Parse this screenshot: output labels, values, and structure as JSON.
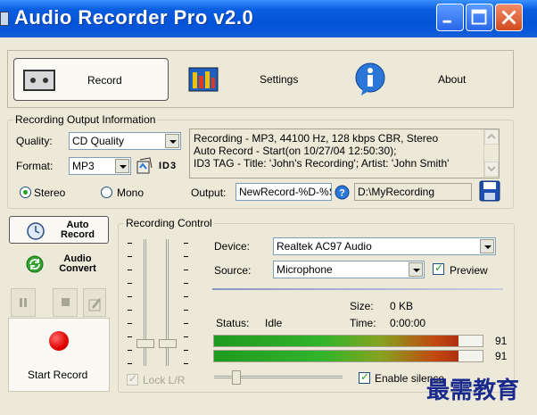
{
  "window": {
    "title": "Audio Recorder Pro v2.0"
  },
  "nav": {
    "record": "Record",
    "settings": "Settings",
    "about": "About"
  },
  "output_info": {
    "group_title": "Recording Output Information",
    "quality_label": "Quality:",
    "quality_value": "CD Quality",
    "format_label": "Format:",
    "format_value": "MP3",
    "id3_label": "ID3",
    "info_lines": [
      "Recording - MP3, 44100 Hz, 128 kbps CBR, Stereo",
      "Auto Record - Start(on 10/27/04 12:50:30);",
      "ID3 TAG - Title: 'John's Recording'; Artist: 'John Smith'"
    ],
    "stereo_label": "Stereo",
    "mono_label": "Mono",
    "selected_channel": "Stereo",
    "output_label": "Output:",
    "output_name": "NewRecord-%D-%S",
    "output_dir": "D:\\MyRecording"
  },
  "side": {
    "auto_record": "Auto\nRecord",
    "audio_convert": "Audio\nConvert",
    "start_record": "Start Record"
  },
  "recording_control": {
    "group_title": "Recording Control",
    "device_label": "Device:",
    "device_value": "Realtek AC97 Audio",
    "source_label": "Source:",
    "source_value": "Microphone",
    "preview_label": "Preview",
    "preview_checked": true,
    "size_label": "Size:",
    "size_value": "0 KB",
    "status_label": "Status:",
    "status_value": "Idle",
    "time_label": "Time:",
    "time_value": "0:00:00",
    "meter_left_value": "91",
    "meter_right_value": "91",
    "meter_left_level": 0.91,
    "meter_right_level": 0.91,
    "lock_label": "Lock L/R",
    "lock_checked": true,
    "enable_silence_label": "Enable silence",
    "enable_silence_checked": true
  },
  "watermark": "最需教育",
  "colors": {
    "titlebar": "#0553d8",
    "close": "#d24a1c",
    "meter_green": "#32b42b",
    "meter_red": "#b03010",
    "record_red": "#e00000",
    "watermark": "#1a2a8c"
  },
  "icons": {
    "record": "cassette-icon",
    "settings": "equalizer-icon",
    "about": "info-icon",
    "auto_record": "clock-icon",
    "audio_convert": "convert-icon",
    "pause": "pause-icon",
    "stop": "stop-icon",
    "save": "floppy-disk-icon",
    "help": "help-icon"
  }
}
